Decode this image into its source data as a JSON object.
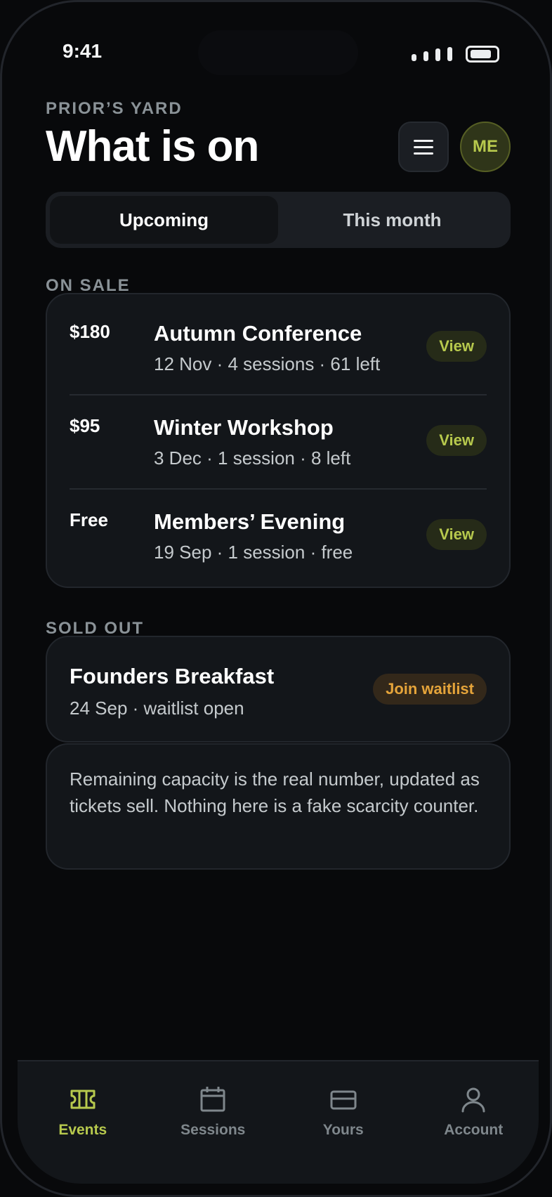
{
  "status_bar": {
    "time": "9:41"
  },
  "header": {
    "eyebrow": "PRIOR’S YARD",
    "title": "What is on",
    "avatar_initials": "ME"
  },
  "segmented": {
    "tabs": [
      {
        "label": "Upcoming",
        "active": true
      },
      {
        "label": "This month",
        "active": false
      }
    ]
  },
  "on_sale": {
    "label": "ON SALE",
    "events": [
      {
        "price": "$180",
        "name": "Autumn Conference",
        "meta": "12 Nov · 4 sessions · 61 left",
        "action": "View"
      },
      {
        "price": "$95",
        "name": "Winter Workshop",
        "meta": "3 Dec · 1 session · 8 left",
        "action": "View"
      },
      {
        "price": "Free",
        "name": "Members’ Evening",
        "meta": "19 Sep · 1 session · free",
        "action": "View"
      }
    ]
  },
  "sold_out": {
    "label": "SOLD OUT",
    "event": {
      "name": "Founders Breakfast",
      "meta": "24 Sep · waitlist open",
      "action": "Join waitlist"
    }
  },
  "note": "Remaining capacity is the real number, updated as tickets sell. Nothing here is a fake scarcity counter.",
  "tabbar": {
    "items": [
      {
        "label": "Events",
        "icon": "ticket-icon",
        "active": true
      },
      {
        "label": "Sessions",
        "icon": "calendar-icon",
        "active": false
      },
      {
        "label": "Yours",
        "icon": "card-icon",
        "active": false
      },
      {
        "label": "Account",
        "icon": "person-icon",
        "active": false
      }
    ]
  },
  "colors": {
    "accent": "#b7c94d",
    "warning": "#e5a43a",
    "background": "#08090b",
    "card": "#13161a"
  }
}
